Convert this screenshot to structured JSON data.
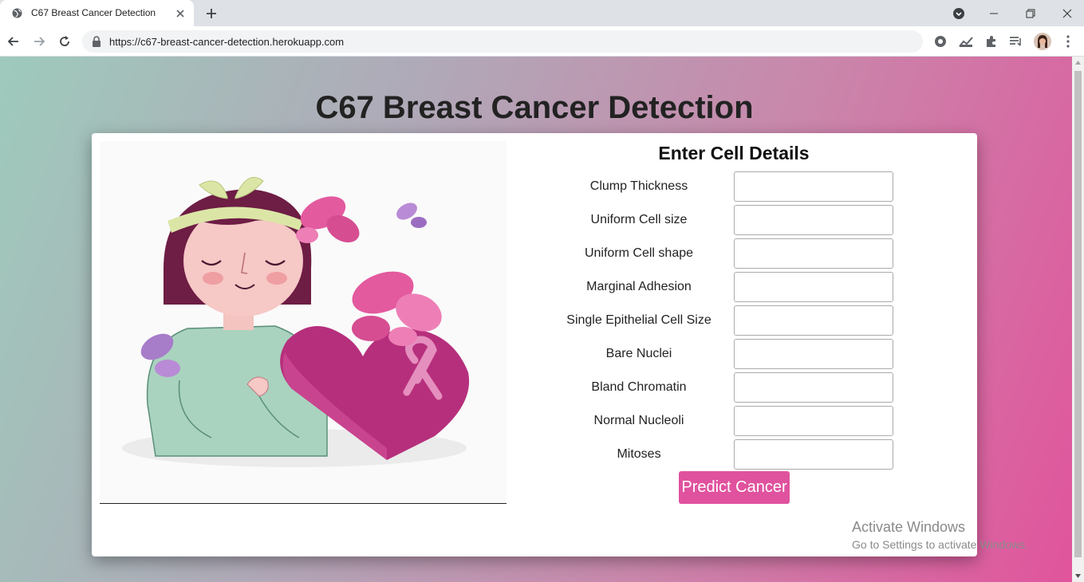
{
  "browser": {
    "tab_title": "C67 Breast Cancer Detection",
    "url": "https://c67-breast-cancer-detection.herokuapp.com"
  },
  "page": {
    "heading": "C67 Breast Cancer Detection",
    "form_title": "Enter Cell Details",
    "fields": [
      {
        "label": "Clump Thickness",
        "value": ""
      },
      {
        "label": "Uniform Cell size",
        "value": ""
      },
      {
        "label": "Uniform Cell shape",
        "value": ""
      },
      {
        "label": "Marginal Adhesion",
        "value": ""
      },
      {
        "label": "Single Epithelial Cell Size",
        "value": ""
      },
      {
        "label": "Bare Nuclei",
        "value": ""
      },
      {
        "label": "Bland Chromatin",
        "value": ""
      },
      {
        "label": "Normal Nucleoli",
        "value": ""
      },
      {
        "label": "Mitoses",
        "value": ""
      }
    ],
    "submit_label": "Predict Cancer"
  },
  "watermark": {
    "line1": "Activate Windows",
    "line2": "Go to Settings to activate Windows."
  },
  "colors": {
    "button": "#e0529e",
    "gradient_start": "#9ecabc",
    "gradient_end": "#e1549c",
    "ribbon": "#e58fbf",
    "heart": "#b62f7c"
  },
  "icons": {
    "favicon": "globe-icon",
    "back": "arrow-left-icon",
    "forward": "arrow-right-icon",
    "reload": "reload-icon",
    "lock": "lock-icon",
    "extensions": "puzzle-icon",
    "menu": "kebab-menu-icon"
  }
}
